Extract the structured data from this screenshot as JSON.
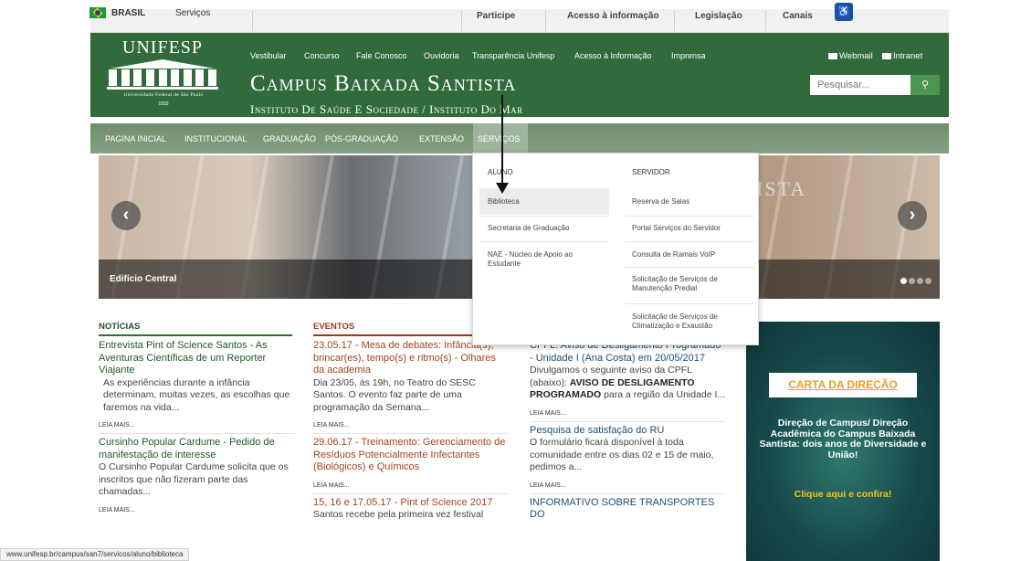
{
  "govbar": {
    "country": "BRASIL",
    "services": "Serviços",
    "links": [
      "Participe",
      "Acesso à informação",
      "Legislação",
      "Canais"
    ]
  },
  "header": {
    "logo_name": "UNIFESP",
    "logo_sub": "Universidade Federal de São Paulo",
    "logo_year": "1933",
    "top_links": [
      "Vestibular",
      "Concurso",
      "Fale Conosco",
      "Ouvidoria",
      "Transparência Unifesp",
      "Acesso à Informação",
      "Imprensa"
    ],
    "title": "Campus Baixada Santista",
    "subtitle": "Instituto De Saúde E Sociedade / Instituto Do Mar",
    "webmail": "Webmail",
    "intranet": "Intranet",
    "search_placeholder": "Pesquisar...",
    "search_icon": "search-icon"
  },
  "menu": {
    "items": [
      "Pagina Inicial",
      "Institucional",
      "Graduação",
      "Pós-Graduação",
      "Extensão",
      "Serviços"
    ],
    "active_index": 5
  },
  "slider": {
    "caption": "Edifício Central",
    "prev": "‹",
    "next": "›",
    "word": "ISTA",
    "slide_count": 4,
    "current_slide": 1
  },
  "dropdown": {
    "aluno_head": "Aluno",
    "aluno_items": [
      "Biblioteca",
      "Secretaria de Graduação",
      "NAE - Núcleo de Apoio ao Estudante"
    ],
    "servidor_head": "Servidor",
    "servidor_items": [
      "Reserva de Salas",
      "Portal Serviços do Servidor",
      "Consulta de Ramais VoIP",
      "Solicitação de Serviços de Manutenção Predial",
      "Solicitação de Serviços de Climatização e Exaustão"
    ]
  },
  "sections": {
    "news": "Notícias",
    "events": "Eventos"
  },
  "news": [
    {
      "title": "Entrevista Pint of Science Santos - As Aventuras Científicas de um Reporter Viajante",
      "text": "As experiências durante a infância determinam, muitas vezes, as escolhas que faremos na vida...",
      "more": "LEIA MAIS..."
    },
    {
      "title": "Cursinho Popular Cardume - Pedido de manifestação de interesse",
      "text": "O Cursinho Popular Cardume solicita que os inscritos que não fizeram parte das chamadas...",
      "more": "LEIA MAIS..."
    }
  ],
  "events": [
    {
      "title": "23.05.17 - Mesa de debates: Infância(s), brincar(es), tempo(s) e ritmo(s) - Olhares da academia",
      "text": "Dia 23/05, às 19h, no Teatro do SESC Santos. O evento faz parte de uma programação da Semana...",
      "more": "LEIA MAIS..."
    },
    {
      "title": "29.06.17 - Treinamento: Gerenciamento de Resíduos Potencialmente Infectantes (Biológicos) e Químicos",
      "more": "LEIA MAIS..."
    },
    {
      "title": "15, 16 e 17.05.17 - Pint of Science 2017",
      "text_partial": "Santos recebe pela primeira vez festival"
    }
  ],
  "info": [
    {
      "title": "CPFL: Aviso de Desligamento Programado - Unidade I (Ana Costa) em 20/05/2017",
      "text_a": "Divulgamos o seguinte aviso da CPFL (abaixo): ",
      "text_bold": "AVISO DE DESLIGAMENTO PROGRAMADO",
      "text_b": " para a região da Unidade I...",
      "more": "LEIA MAIS..."
    },
    {
      "title": "Pesquisa de satisfação do RU",
      "text": "O formulário ficará disponível à toda comunidade entre os dias 02 e 15 de maio, pedimos a...",
      "more": "LEIA MAIS..."
    },
    {
      "title": "INFORMATIVO SOBRE TRANSPORTES DO"
    }
  ],
  "director": {
    "button": "CARTA DA DIREÇÃO",
    "text": "Direção de Campus/ Direção Acadêmica do Campus Baixada Santista: dois anos de Diversidade e União!",
    "link": "Clique aqui e confira!"
  },
  "status_url": "www.unifesp.br/campus/san7/servicos/aluno/biblioteca"
}
